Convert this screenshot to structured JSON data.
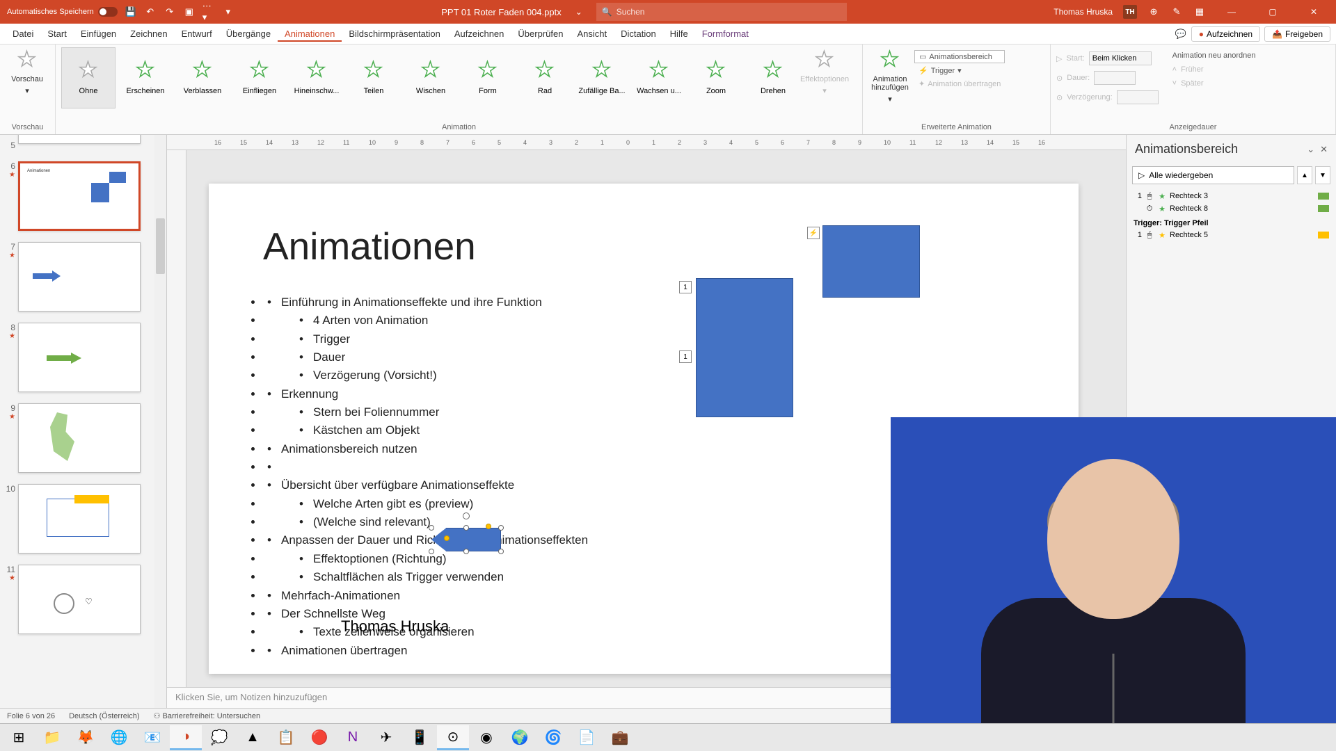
{
  "titlebar": {
    "autosave": "Automatisches Speichern",
    "filename": "PPT 01 Roter Faden 004.pptx",
    "search_placeholder": "Suchen",
    "user": "Thomas Hruska",
    "user_initials": "TH"
  },
  "menu": {
    "items": [
      "Datei",
      "Start",
      "Einfügen",
      "Zeichnen",
      "Entwurf",
      "Übergänge",
      "Animationen",
      "Bildschirmpräsentation",
      "Aufzeichnen",
      "Überprüfen",
      "Ansicht",
      "Dictation",
      "Hilfe",
      "Formformat"
    ],
    "record": "Aufzeichnen",
    "share": "Freigeben"
  },
  "ribbon": {
    "preview_group": "Vorschau",
    "preview_btn": "Vorschau",
    "anim_group": "Animation",
    "effects": [
      "Ohne",
      "Erscheinen",
      "Verblassen",
      "Einfliegen",
      "Hineinschw...",
      "Teilen",
      "Wischen",
      "Form",
      "Rad",
      "Zufällige Ba...",
      "Wachsen u...",
      "Zoom",
      "Drehen"
    ],
    "effect_options": "Effektoptionen",
    "advanced_group": "Erweiterte Animation",
    "add_anim": "Animation hinzufügen",
    "anim_pane": "Animationsbereich",
    "trigger": "Trigger",
    "copy_anim": "Animation übertragen",
    "timing_group": "Anzeigedauer",
    "start_label": "Start:",
    "start_value": "Beim Klicken",
    "duration_label": "Dauer:",
    "delay_label": "Verzögerung:",
    "reorder": "Animation neu anordnen",
    "earlier": "Früher",
    "later": "Später"
  },
  "thumbnails": {
    "numbers": [
      "5",
      "6",
      "7",
      "8",
      "9",
      "10",
      "11"
    ]
  },
  "slide": {
    "title": "Animationen",
    "bullets": [
      {
        "l": 1,
        "t": "Einführung in Animationseffekte und ihre Funktion"
      },
      {
        "l": 2,
        "t": "4 Arten von Animation"
      },
      {
        "l": 2,
        "t": "Trigger"
      },
      {
        "l": 2,
        "t": "Dauer"
      },
      {
        "l": 2,
        "t": "Verzögerung (Vorsicht!)"
      },
      {
        "l": 1,
        "t": "Erkennung"
      },
      {
        "l": 2,
        "t": "Stern bei Foliennummer"
      },
      {
        "l": 2,
        "t": "Kästchen am Objekt"
      },
      {
        "l": 1,
        "t": "Animationsbereich nutzen"
      },
      {
        "l": 1,
        "t": " "
      },
      {
        "l": 1,
        "t": "Übersicht über verfügbare Animationseffekte"
      },
      {
        "l": 2,
        "t": "Welche Arten gibt es (preview)"
      },
      {
        "l": 2,
        "t": "(Welche sind relevant)"
      },
      {
        "l": 1,
        "t": "Anpassen der Dauer und Richtung von Animationseffekten"
      },
      {
        "l": 2,
        "t": "Effektoptionen (Richtung)"
      },
      {
        "l": 2,
        "t": "Schaltflächen als Trigger verwenden"
      },
      {
        "l": 1,
        "t": "Mehrfach-Animationen"
      },
      {
        "l": 1,
        "t": "Der Schnellste Weg"
      },
      {
        "l": 2,
        "t": "Texte zeilenweise organisieren"
      },
      {
        "l": 1,
        "t": "Animationen übertragen"
      }
    ],
    "author": "Thomas Hruska",
    "tag1": "1",
    "tag2": "1",
    "tag_trigger": "⚡"
  },
  "notes": {
    "placeholder": "Klicken Sie, um Notizen hinzuzufügen"
  },
  "anim_pane": {
    "title": "Animationsbereich",
    "play_all": "Alle wiedergeben",
    "items": [
      {
        "num": "1",
        "name": "Rechteck 3",
        "color": "#70ad47"
      },
      {
        "num": "",
        "name": "Rechteck 8",
        "color": "#70ad47"
      }
    ],
    "trigger_header": "Trigger: Trigger Pfeil",
    "trigger_items": [
      {
        "num": "1",
        "name": "Rechteck 5",
        "color": "#ffc000"
      }
    ]
  },
  "statusbar": {
    "slide_info": "Folie 6 von 26",
    "language": "Deutsch (Österreich)",
    "accessibility": "Barrierefreiheit: Untersuchen"
  }
}
